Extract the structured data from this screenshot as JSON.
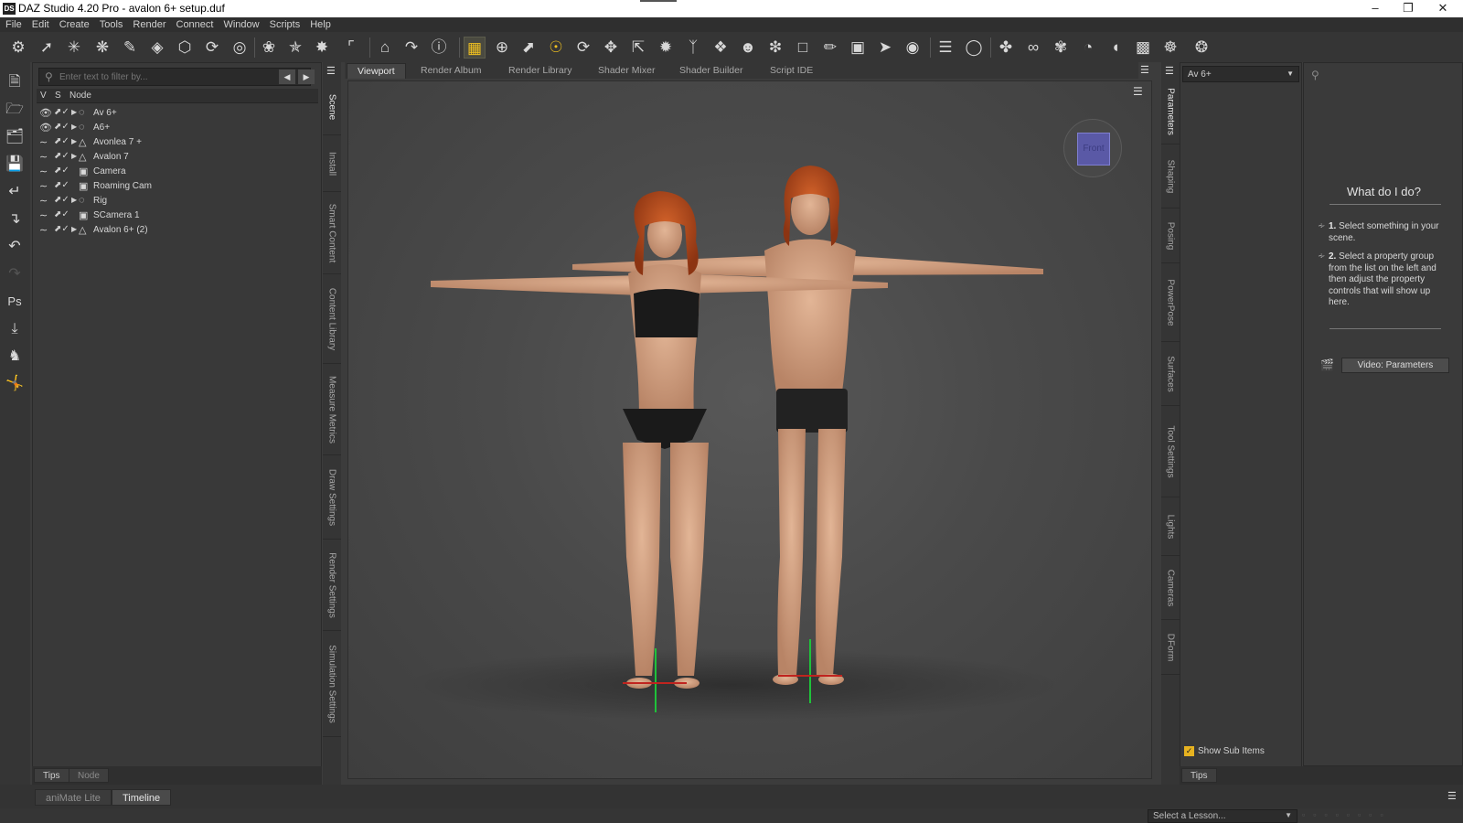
{
  "window": {
    "title": "DAZ Studio 4.20 Pro - avalon 6+ setup.duf",
    "logo": "DS"
  },
  "menu": [
    "File",
    "Edit",
    "Create",
    "Tools",
    "Render",
    "Connect",
    "Window",
    "Scripts",
    "Help"
  ],
  "toolbar_icons": [
    "scene-figure-icon",
    "pose-tool-icon",
    "joint-tool-icon",
    "universal-tool-icon",
    "node-weight-icon",
    "geometry-editor-icon",
    "transform-icon",
    "rotate-geom-icon",
    "region-nav-icon",
    "surface-selection-icon",
    "lasso-icon",
    "bend-icon",
    "deform-icon",
    "measure-icon",
    "home-icon",
    "whats-this-icon",
    "help-icon",
    "node-selection-icon",
    "universal-manip-icon",
    "pointer-icon",
    "spot-render-icon",
    "rotate-icon",
    "translate-icon",
    "scale-icon",
    "edit-toolbox-icon",
    "active-pose-icon",
    "joint-editor-icon",
    "figure-setup-icon",
    "pose-converter-icon",
    "physics-icon",
    "paint-icon",
    "camera-icon",
    "screenshot-icon",
    "align-icon",
    "unknown-icon",
    "knife-icon",
    "link-icon",
    "morph-icon",
    "bulge-icon",
    "bridge-icon",
    "grid-icon",
    "world-icon",
    "teleport-icon"
  ],
  "left_tools": [
    "new-scene-icon",
    "open-icon",
    "merge-icon",
    "save-icon",
    "import-icon",
    "export-icon",
    "undo-icon",
    "redo-icon",
    "photoshop-bridge-icon",
    "drop-to-floor-icon",
    "figure-icon",
    "pose-icon"
  ],
  "scene": {
    "filter_placeholder": "Enter text to filter by...",
    "columns": {
      "v": "V",
      "s": "S",
      "node": "Node"
    },
    "nodes": [
      {
        "label": "Av 6+",
        "icon": "bone-icon"
      },
      {
        "label": "A6+",
        "icon": "bone-icon"
      },
      {
        "label": "Avonlea 7 +",
        "icon": "figure-icon"
      },
      {
        "label": "Avalon 7",
        "icon": "figure-icon"
      },
      {
        "label": "Camera",
        "icon": "camera-icon"
      },
      {
        "label": "Roaming Cam",
        "icon": "camera-icon"
      },
      {
        "label": "Rig",
        "icon": "bone-icon"
      },
      {
        "label": "SCamera 1",
        "icon": "camera-icon"
      },
      {
        "label": "Avalon 6+ (2)",
        "icon": "figure-icon"
      }
    ],
    "bottom_tabs": [
      "Tips",
      "Node"
    ]
  },
  "left_vtabs": [
    "Scene",
    "Install",
    "Smart Content",
    "Content Library",
    "Measure Metrics",
    "Draw Settings",
    "Render Settings",
    "Simulation Settings"
  ],
  "viewport_tabs": [
    "Viewport",
    "Render Album",
    "Render Library",
    "Shader Mixer",
    "Shader Builder",
    "Script IDE"
  ],
  "view_cube": {
    "face": "Front",
    "color": "#5a59a6"
  },
  "right_vtabs": [
    "Parameters",
    "Shaping",
    "Posing",
    "PowerPose",
    "Surfaces",
    "Tool Settings",
    "Lights",
    "Cameras",
    "DForm"
  ],
  "parameters": {
    "selected": "Av 6+",
    "show_sub_items": "Show Sub Items",
    "tab": "Tips"
  },
  "help": {
    "question": "What do I do?",
    "steps": [
      {
        "num": "1.",
        "text": "Select something in your scene."
      },
      {
        "num": "2.",
        "text": "Select a property group from the list on the left and then adjust the property controls that will show up here."
      }
    ],
    "video_button": "Video: Parameters"
  },
  "bottom_tabs": [
    "aniMate Lite",
    "Timeline"
  ],
  "lesson": {
    "placeholder": "Select a Lesson..."
  },
  "colors": {
    "accent": "#e7b320",
    "panel": "#393939",
    "background": "#3c3c3c"
  }
}
